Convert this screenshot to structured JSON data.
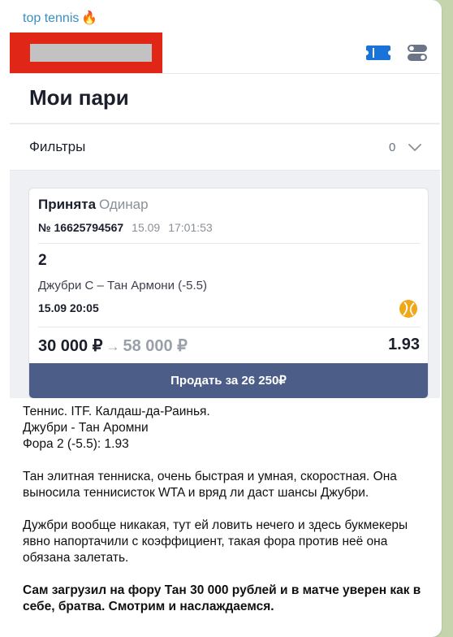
{
  "post": {
    "channel_name": "top tennis",
    "channel_emoji": "🔥"
  },
  "app": {
    "title": "Мои пари",
    "filters_label": "Фильтры",
    "filters_count": "0"
  },
  "bet": {
    "status": "Принята",
    "type": "Одинар",
    "number": "№ 16625794567",
    "date": "15.09",
    "time": "17:01:53",
    "pick": "2",
    "match": "Джубри С – Тан Армони (-5.5)",
    "match_time": "15.09 20:05",
    "stake": "30 000 ₽",
    "arrow": "→",
    "potential_win": "58 000 ₽",
    "odds": "1.93",
    "sell_label": "Продать за 26 250₽"
  },
  "message": {
    "line1": "Теннис. ITF. Калдаш-да-Раинья.",
    "line2": "Джубри - Тан Аромни",
    "line3": "Фора 2 (-5.5): 1.93",
    "para2": "Тан элитная тенниска, очень быстрая и умная, скоростная. Она выносила теннисисток WTA и вряд ли даст шансы Джубри.",
    "para3": "Дужбри вообще никакая, тут ей ловить нечего и здесь букмекеры явно напортачили с коэффициент, такая фора против неё она обязана залетать.",
    "para4": "Сам загрузил на фору Тан 30 000 рублей и в матче уверен как в себе, братва. Смотрим и наслаждаемся."
  },
  "colors": {
    "channel": "#3a8fc4",
    "sell_button": "#4c5d87",
    "redaction": "#e02616",
    "icon_blue": "#1a73d9",
    "ball": "#f0a81a"
  },
  "icons": {
    "ticket": "ticket-icon",
    "toggle": "settings-toggle-icon",
    "chevron": "chevron-down-icon",
    "ball": "tennis-ball-icon"
  }
}
